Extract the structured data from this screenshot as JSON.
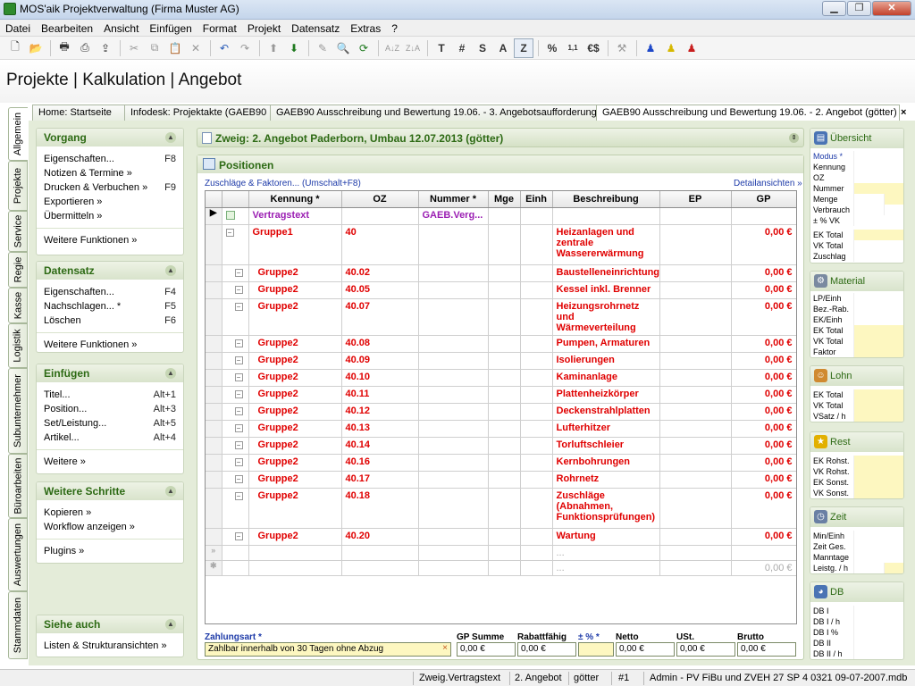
{
  "window": {
    "title": "MOS'aik Projektverwaltung (Firma Muster AG)"
  },
  "menu": [
    "Datei",
    "Bearbeiten",
    "Ansicht",
    "Einfügen",
    "Format",
    "Projekt",
    "Datensatz",
    "Extras",
    "?"
  ],
  "toolbar": {
    "text_buttons": [
      "T",
      "#",
      "S",
      "A",
      "Z"
    ],
    "icons": [
      "new-icon",
      "open-icon",
      "print-icon",
      "preview-icon",
      "export-icon",
      "cut-icon",
      "copy-icon",
      "paste-icon",
      "delete-icon",
      "undo-icon",
      "redo-icon",
      "up-icon",
      "down-icon",
      "edit-icon",
      "search-icon",
      "refresh-icon",
      "sort-asc-icon",
      "sort-desc-icon",
      "percent-icon",
      "number-format-icon",
      "currency-icon",
      "tool-icon",
      "user-blue-icon",
      "user-yellow-icon",
      "user-red-icon"
    ]
  },
  "heading": "Projekte | Kalkulation | Angebot",
  "tabs": [
    "Home: Startseite",
    "Infodesk: Projektakte (GAEB90",
    "GAEB90 Ausschreibung und Bewertung 19.06. - 3. Angebotsaufforderung",
    "GAEB90 Ausschreibung und Bewertung 19.06. - 2. Angebot (götter)"
  ],
  "tab_close": "×",
  "vertical_tabs": [
    "Allgemein",
    "Projekte",
    "Service",
    "Regie",
    "Kasse",
    "Logistik",
    "Subunternehmer",
    "Büroarbeiten",
    "Auswertungen",
    "Stammdaten"
  ],
  "left": {
    "vorgang": {
      "title": "Vorgang",
      "items": [
        {
          "label": "Eigenschaften...",
          "shortcut": "F8"
        },
        {
          "label": "Notizen & Termine »",
          "shortcut": ""
        },
        {
          "label": "Drucken & Verbuchen »",
          "shortcut": "F9"
        },
        {
          "label": "Exportieren »",
          "shortcut": ""
        },
        {
          "label": "Übermitteln »",
          "shortcut": ""
        }
      ],
      "more": "Weitere Funktionen »"
    },
    "datensatz": {
      "title": "Datensatz",
      "items": [
        {
          "label": "Eigenschaften...",
          "shortcut": "F4"
        },
        {
          "label": "Nachschlagen... *",
          "shortcut": "F5"
        },
        {
          "label": "Löschen",
          "shortcut": "F6"
        }
      ],
      "more": "Weitere Funktionen »"
    },
    "einfuegen": {
      "title": "Einfügen",
      "items": [
        {
          "label": "Titel...",
          "shortcut": "Alt+1"
        },
        {
          "label": "Position...",
          "shortcut": "Alt+3"
        },
        {
          "label": "Set/Leistung...",
          "shortcut": "Alt+5"
        },
        {
          "label": "Artikel...",
          "shortcut": "Alt+4"
        }
      ],
      "more": "Weitere »"
    },
    "weitere": {
      "title": "Weitere Schritte",
      "items": [
        "Kopieren »",
        "Workflow anzeigen »"
      ],
      "more": "Plugins »"
    },
    "siehe": {
      "title": "Siehe auch",
      "items": [
        "Listen & Strukturansichten »"
      ]
    }
  },
  "center": {
    "zweig": "Zweig: 2. Angebot Paderborn, Umbau 12.07.2013 (götter)",
    "positions_title": "Positionen",
    "zuschlaege_link": "Zuschläge & Faktoren... (Umschalt+F8)",
    "details_link": "Detailansichten »",
    "columns": [
      "Kennung *",
      "OZ",
      "Nummer *",
      "Mge",
      "Einh",
      "Beschreibung",
      "EP",
      "GP"
    ],
    "rows": [
      {
        "kennung": "Vertragstext",
        "oz": "",
        "nummer": "GAEB.Verg...",
        "beschreibung": "",
        "gp": "",
        "type": "purple",
        "arrow": true,
        "h": 19
      },
      {
        "kennung": "Gruppe1",
        "oz": "40",
        "nummer": "",
        "beschreibung": "Heizanlagen und zentrale Wassererwärmung",
        "gp": "0,00 €",
        "type": "red",
        "indent": 0,
        "h": 45
      },
      {
        "kennung": "Gruppe2",
        "oz": "40.02",
        "nummer": "",
        "beschreibung": "Baustelleneinrichtung",
        "gp": "0,00 €",
        "type": "red",
        "indent": 1,
        "h": 19
      },
      {
        "kennung": "Gruppe2",
        "oz": "40.05",
        "nummer": "",
        "beschreibung": "Kessel inkl. Brenner",
        "gp": "0,00 €",
        "type": "red",
        "indent": 1,
        "h": 19
      },
      {
        "kennung": "Gruppe2",
        "oz": "40.07",
        "nummer": "",
        "beschreibung": "Heizungsrohrnetz und Wärmeverteilung",
        "gp": "0,00 €",
        "type": "red",
        "indent": 1,
        "h": 32
      },
      {
        "kennung": "Gruppe2",
        "oz": "40.08",
        "nummer": "",
        "beschreibung": "Pumpen, Armaturen",
        "gp": "0,00 €",
        "type": "red",
        "indent": 1,
        "h": 19
      },
      {
        "kennung": "Gruppe2",
        "oz": "40.09",
        "nummer": "",
        "beschreibung": "Isolierungen",
        "gp": "0,00 €",
        "type": "red",
        "indent": 1,
        "h": 19
      },
      {
        "kennung": "Gruppe2",
        "oz": "40.10",
        "nummer": "",
        "beschreibung": "Kaminanlage",
        "gp": "0,00 €",
        "type": "red",
        "indent": 1,
        "h": 19
      },
      {
        "kennung": "Gruppe2",
        "oz": "40.11",
        "nummer": "",
        "beschreibung": "Plattenheizkörper",
        "gp": "0,00 €",
        "type": "red",
        "indent": 1,
        "h": 19
      },
      {
        "kennung": "Gruppe2",
        "oz": "40.12",
        "nummer": "",
        "beschreibung": "Deckenstrahlplatten",
        "gp": "0,00 €",
        "type": "red",
        "indent": 1,
        "h": 19
      },
      {
        "kennung": "Gruppe2",
        "oz": "40.13",
        "nummer": "",
        "beschreibung": "Lufterhitzer",
        "gp": "0,00 €",
        "type": "red",
        "indent": 1,
        "h": 19
      },
      {
        "kennung": "Gruppe2",
        "oz": "40.14",
        "nummer": "",
        "beschreibung": "Torluftschleier",
        "gp": "0,00 €",
        "type": "red",
        "indent": 1,
        "h": 19
      },
      {
        "kennung": "Gruppe2",
        "oz": "40.16",
        "nummer": "",
        "beschreibung": "Kernbohrungen",
        "gp": "0,00 €",
        "type": "red",
        "indent": 1,
        "h": 19
      },
      {
        "kennung": "Gruppe2",
        "oz": "40.17",
        "nummer": "",
        "beschreibung": "Rohrnetz",
        "gp": "0,00 €",
        "type": "red",
        "indent": 1,
        "h": 19
      },
      {
        "kennung": "Gruppe2",
        "oz": "40.18",
        "nummer": "",
        "beschreibung": "Zuschläge (Abnahmen, Funktionsprüfungen)",
        "gp": "0,00 €",
        "type": "red",
        "indent": 1,
        "h": 45
      },
      {
        "kennung": "Gruppe2",
        "oz": "40.20",
        "nummer": "",
        "beschreibung": "Wartung",
        "gp": "0,00 €",
        "type": "red",
        "indent": 1,
        "h": 19
      },
      {
        "kennung": "",
        "oz": "",
        "nummer": "",
        "beschreibung": "...",
        "gp": "",
        "type": "grey",
        "h": 17
      },
      {
        "kennung": "",
        "oz": "",
        "nummer": "",
        "beschreibung": "...",
        "gp": "0,00 €",
        "type": "grey",
        "h": 17
      }
    ],
    "footer": {
      "zahlungsart_label": "Zahlungsart *",
      "zahlungsart_value": "Zahlbar innerhalb von 30 Tagen ohne Abzug",
      "zahlungsart_clear": "×",
      "gp_summe_label": "GP Summe",
      "gp_summe_value": "0,00 €",
      "rabatt_label": "Rabattfähig",
      "rabatt_value": "0,00 €",
      "pct_label": "± % *",
      "pct_value": "",
      "netto_label": "Netto",
      "netto_value": "0,00 €",
      "ust_label": "USt.",
      "ust_value": "0,00 €",
      "brutto_label": "Brutto",
      "brutto_value": "0,00 €"
    }
  },
  "right": {
    "uebersicht": {
      "title": "Übersicht",
      "modus": "Modus *",
      "rows": [
        "Kennung",
        "OZ",
        "Nummer",
        "Menge",
        "Verbrauch",
        "± % VK"
      ],
      "rows2": [
        "EK Total",
        "VK Total",
        "Zuschlag"
      ]
    },
    "material": {
      "title": "Material",
      "rows": [
        "LP/Einh",
        "Bez.-Rab.",
        "EK/Einh",
        "EK Total",
        "VK Total",
        "Faktor"
      ]
    },
    "lohn": {
      "title": "Lohn",
      "rows": [
        "EK Total",
        "VK Total",
        "VSatz / h"
      ]
    },
    "rest": {
      "title": "Rest",
      "rows": [
        "EK Rohst.",
        "VK Rohst.",
        "EK Sonst.",
        "VK Sonst."
      ]
    },
    "zeit": {
      "title": "Zeit",
      "rows": [
        "Min/Einh",
        "Zeit Ges.",
        "Manntage",
        "Leistg. / h"
      ]
    },
    "db": {
      "title": "DB",
      "rows": [
        "DB I",
        "DB I / h",
        "DB I %",
        "DB II",
        "DB II / h"
      ]
    }
  },
  "status": {
    "kennung": "Zweig.Vertragstext",
    "angebot": "2. Angebot",
    "user": "götter",
    "num": "#1",
    "db": "Admin - PV FiBu und ZVEH 27 SP 4 0321 09-07-2007.mdb"
  },
  "colors": {
    "accent_green": "#2d6a14",
    "group_red": "#e00000",
    "text_purple": "#9b1fb3",
    "field_yellow": "#fdf7c0"
  }
}
